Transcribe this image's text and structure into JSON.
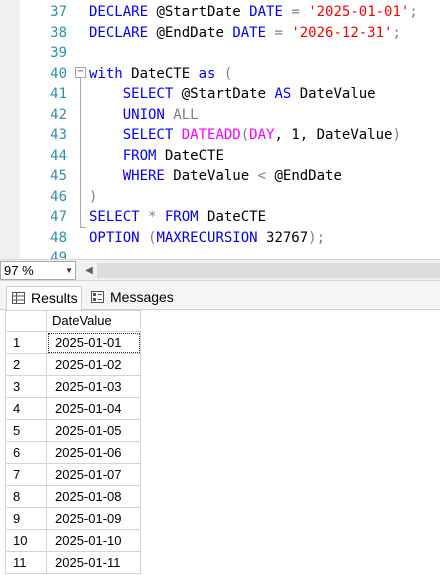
{
  "editor": {
    "line_numbers": [
      "37",
      "38",
      "39",
      "40",
      "41",
      "42",
      "43",
      "44",
      "45",
      "46",
      "47",
      "48",
      "49"
    ],
    "code": {
      "l37": {
        "kw1": "DECLARE",
        "var": " @StartDate ",
        "kw2": "DATE",
        "op": " = ",
        "str": "'2025-01-01'",
        "end": ";"
      },
      "l38": {
        "kw1": "DECLARE",
        "var": " @EndDate ",
        "kw2": "DATE",
        "op": " = ",
        "str": "'2026-12-31'",
        "end": ";"
      },
      "l40": {
        "kw1": "with",
        "name": " DateCTE ",
        "kw2": "as",
        "paren": " ("
      },
      "l41": {
        "indent": "    ",
        "kw1": "SELECT",
        "var": " @StartDate ",
        "kw2": "AS",
        "col": " DateValue"
      },
      "l42": {
        "indent": "    ",
        "kw1": "UNION",
        "op": " ALL"
      },
      "l43": {
        "indent": "    ",
        "kw1": "SELECT",
        "fn": " DATEADD",
        "p1": "(",
        "kw2": "DAY",
        "rest": ", 1, DateValue",
        "p2": ")"
      },
      "l44": {
        "indent": "    ",
        "kw1": "FROM",
        "rest": " DateCTE"
      },
      "l45": {
        "indent": "    ",
        "kw1": "WHERE",
        "rest": " DateValue ",
        "op": "<",
        "var": " @EndDate"
      },
      "l46": {
        "paren": ")"
      },
      "l47": {
        "kw1": "SELECT",
        "op": " * ",
        "kw2": "FROM",
        "rest": " DateCTE"
      },
      "l48": {
        "kw1": "OPTION",
        "p1": " (",
        "kw2": "MAXRECURSION",
        "num": " 32767",
        "p2": ")",
        "end": ";"
      }
    },
    "fold_symbol": "−"
  },
  "status": {
    "zoom": "97 %",
    "zoom_arrow": "▼",
    "scroll_left": "◀"
  },
  "tabs": {
    "results": "Results",
    "messages": "Messages"
  },
  "grid": {
    "columns": [
      "DateValue"
    ],
    "rows": [
      {
        "n": "1",
        "value": "2025-01-01"
      },
      {
        "n": "2",
        "value": "2025-01-02"
      },
      {
        "n": "3",
        "value": "2025-01-03"
      },
      {
        "n": "4",
        "value": "2025-01-04"
      },
      {
        "n": "5",
        "value": "2025-01-05"
      },
      {
        "n": "6",
        "value": "2025-01-06"
      },
      {
        "n": "7",
        "value": "2025-01-07"
      },
      {
        "n": "8",
        "value": "2025-01-08"
      },
      {
        "n": "9",
        "value": "2025-01-09"
      },
      {
        "n": "10",
        "value": "2025-01-10"
      },
      {
        "n": "11",
        "value": "2025-01-11"
      }
    ]
  }
}
